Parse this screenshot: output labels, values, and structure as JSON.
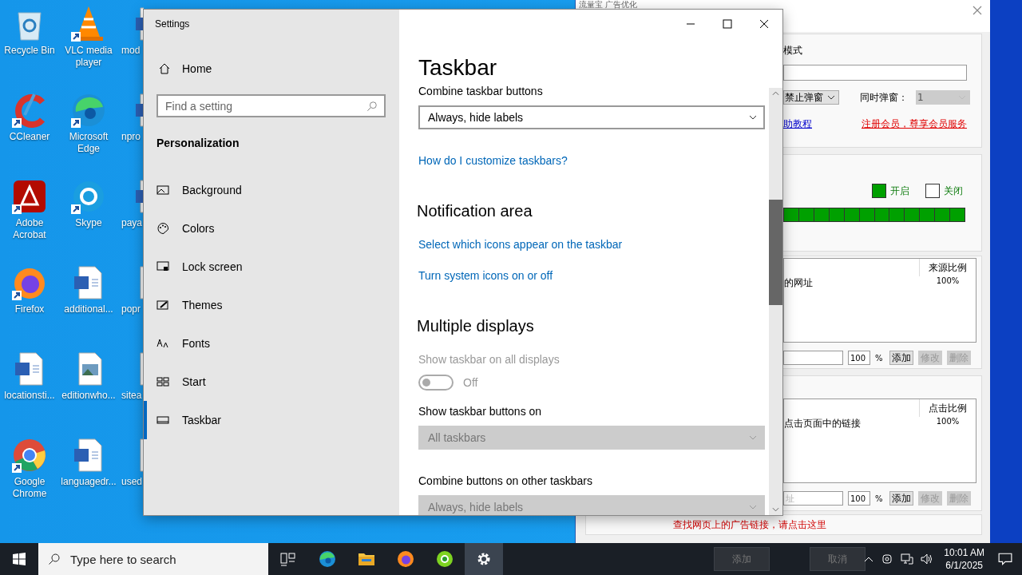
{
  "desktop": {
    "icons": [
      {
        "label": "Recycle Bin",
        "kind": "recycle",
        "shortcut": false
      },
      {
        "label": "CCleaner",
        "kind": "ccleaner",
        "shortcut": true
      },
      {
        "label": "Adobe Acrobat",
        "kind": "acrobat",
        "shortcut": true
      },
      {
        "label": "Firefox",
        "kind": "firefox",
        "shortcut": true
      },
      {
        "label": "locationsti...",
        "kind": "word",
        "shortcut": false
      },
      {
        "label": "Google Chrome",
        "kind": "chrome",
        "shortcut": true
      },
      {
        "label": "VLC media player",
        "kind": "vlc",
        "shortcut": true
      },
      {
        "label": "Microsoft Edge",
        "kind": "edge",
        "shortcut": true
      },
      {
        "label": "Skype",
        "kind": "skype",
        "shortcut": true
      },
      {
        "label": "additional...",
        "kind": "word",
        "shortcut": false
      },
      {
        "label": "editionwho...",
        "kind": "image",
        "shortcut": false
      },
      {
        "label": "languagedr...",
        "kind": "word",
        "shortcut": false
      },
      {
        "label": "mod",
        "kind": "word",
        "shortcut": false
      },
      {
        "label": "npro",
        "kind": "word",
        "shortcut": false
      },
      {
        "label": "paya",
        "kind": "word",
        "shortcut": false
      },
      {
        "label": "popr",
        "kind": "image",
        "shortcut": false
      },
      {
        "label": "sitea",
        "kind": "image",
        "shortcut": false
      },
      {
        "label": "used",
        "kind": "image",
        "shortcut": false
      }
    ]
  },
  "ad_window": {
    "title": "流量宝 广告优化",
    "mode_label": "模式",
    "popup_select": "禁止弹窗",
    "popup_count_label": "同时弹窗：",
    "popup_count": "1",
    "help_link": "助教程",
    "member_link": "注册会员，尊享会员服务",
    "switch_options": [
      {
        "label": "开启",
        "checked": true
      },
      {
        "label": "关闭",
        "checked": false
      }
    ],
    "source_list": {
      "header": "来源比例",
      "rows": [
        {
          "name": "的网址",
          "ratio": "100%"
        }
      ],
      "ratio_input": "100",
      "percent": "%",
      "buttons": [
        {
          "label": "添加",
          "disabled": false
        },
        {
          "label": "修改",
          "disabled": true
        },
        {
          "label": "删除",
          "disabled": true
        }
      ]
    },
    "click_list": {
      "header": "点击比例",
      "rows": [
        {
          "name": "点击页面中的链接",
          "ratio": "100%"
        }
      ],
      "url_placeholder": "址",
      "ratio_input": "100",
      "percent": "%",
      "buttons": [
        {
          "label": "添加",
          "disabled": false
        },
        {
          "label": "修改",
          "disabled": true
        },
        {
          "label": "删除",
          "disabled": true
        }
      ]
    },
    "find_ads_link": "查找网页上的广告链接，请点击这里",
    "dialog_buttons": [
      "添加",
      "取消"
    ]
  },
  "settings_window": {
    "title": "Settings",
    "home": "Home",
    "search_placeholder": "Find a setting",
    "section": "Personalization",
    "nav": [
      {
        "label": "Background",
        "kind": "background",
        "selected": false
      },
      {
        "label": "Colors",
        "kind": "colors",
        "selected": false
      },
      {
        "label": "Lock screen",
        "kind": "lock",
        "selected": false
      },
      {
        "label": "Themes",
        "kind": "themes",
        "selected": false
      },
      {
        "label": "Fonts",
        "kind": "fonts",
        "selected": false
      },
      {
        "label": "Start",
        "kind": "start",
        "selected": false
      },
      {
        "label": "Taskbar",
        "kind": "taskbar",
        "selected": true
      }
    ],
    "page_title": "Taskbar",
    "blocks": [
      {
        "kind": "label",
        "text": "Combine taskbar buttons",
        "disabled": false
      },
      {
        "kind": "dropdown",
        "text": "Always, hide labels",
        "disabled": false
      },
      {
        "kind": "link",
        "text": "How do I customize taskbars?"
      },
      {
        "kind": "heading",
        "text": "Notification area"
      },
      {
        "kind": "link",
        "text": "Select which icons appear on the taskbar"
      },
      {
        "kind": "link",
        "text": "Turn system icons on or off"
      },
      {
        "kind": "heading",
        "text": "Multiple displays"
      },
      {
        "kind": "label",
        "text": "Show taskbar on all displays",
        "disabled": true
      },
      {
        "kind": "toggle",
        "text": "Off",
        "on": false,
        "disabled": true
      },
      {
        "kind": "label",
        "text": "Show taskbar buttons on",
        "disabled": false
      },
      {
        "kind": "dropdown",
        "text": "All taskbars",
        "disabled": true
      },
      {
        "kind": "label",
        "text": "Combine buttons on other taskbars",
        "disabled": false
      },
      {
        "kind": "dropdown",
        "text": "Always, hide labels",
        "disabled": true
      }
    ]
  },
  "taskbar": {
    "search_placeholder": "Type here to search",
    "apps": [
      {
        "kind": "taskview",
        "active": false
      },
      {
        "kind": "edge",
        "active": false
      },
      {
        "kind": "explorer",
        "active": false
      },
      {
        "kind": "firefox",
        "active": false
      },
      {
        "kind": "green",
        "active": false
      },
      {
        "kind": "settings",
        "active": true
      }
    ],
    "time": "10:01 AM",
    "date": "6/1/2025"
  }
}
